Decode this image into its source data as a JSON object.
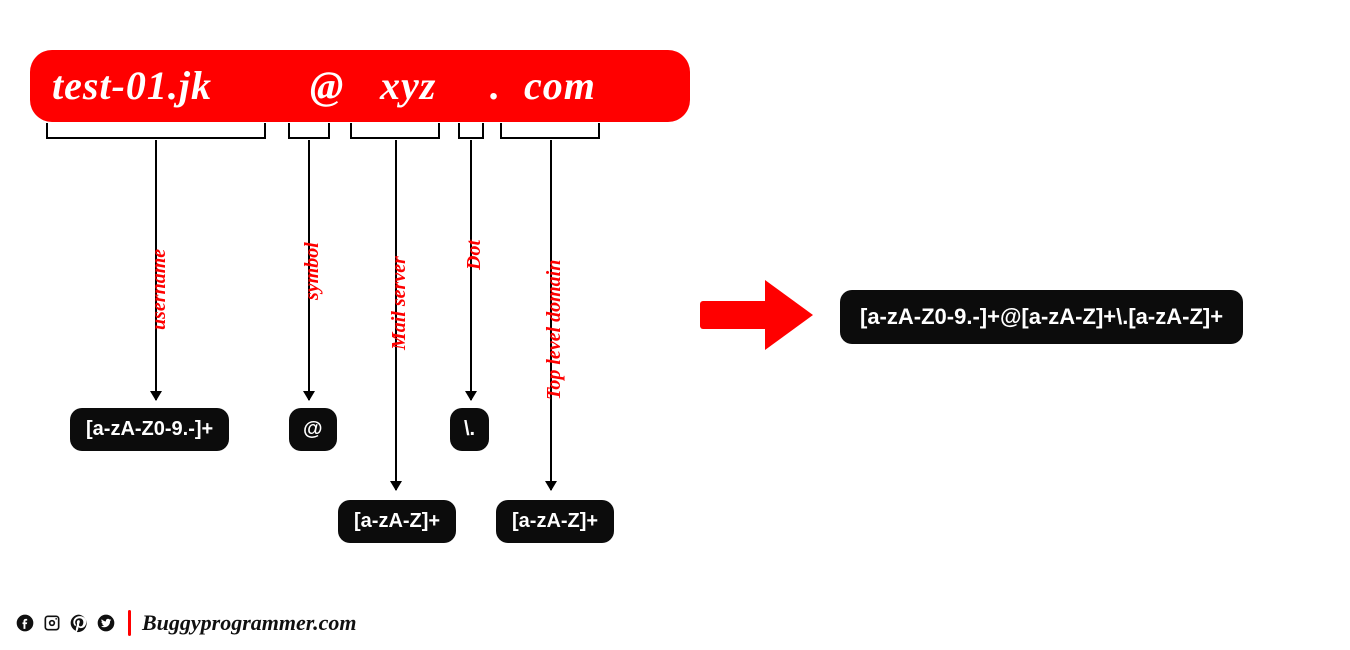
{
  "email": {
    "user": "test-01.jk",
    "at": "@",
    "server": "xyz",
    "dot": ".",
    "tld": "com"
  },
  "labels": {
    "user": "username",
    "at": "symbol",
    "server": "Mail server",
    "dot": "Dot",
    "tld": "Top level domain"
  },
  "regex": {
    "user": "[a-zA-Z0-9.-]+",
    "at": "@",
    "server": "[a-zA-Z]+",
    "dot": "\\.",
    "tld": "[a-zA-Z]+",
    "final": "[a-zA-Z0-9.-]+@[a-zA-Z]+\\.[a-zA-Z]+"
  },
  "footer": {
    "site": "Buggyprogrammer.com"
  },
  "colors": {
    "accent": "#ff0000",
    "box": "#0c0c0c",
    "text": "#ffffff"
  }
}
